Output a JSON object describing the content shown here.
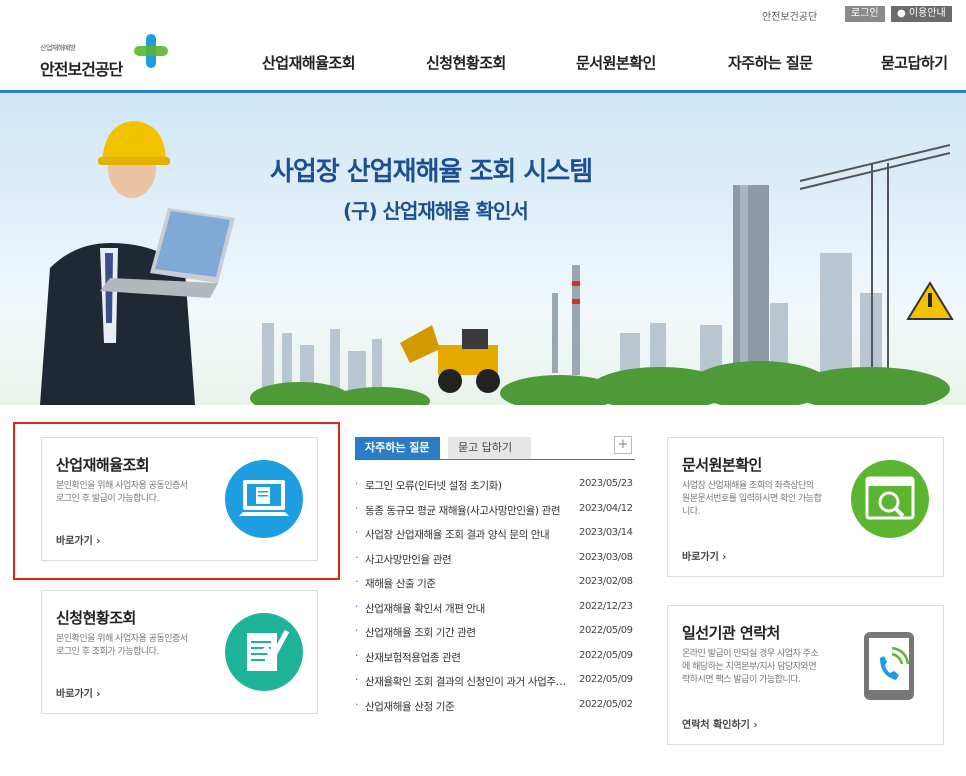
{
  "util": {
    "agency": "안전보건공단",
    "login": "로그인",
    "guide": "이용안내"
  },
  "logo": {
    "tagline": "산업재해예방",
    "name": "안전보건공단"
  },
  "nav": [
    "산업재해율조회",
    "신청현황조회",
    "문서원본확인",
    "자주하는 질문",
    "묻고답하기"
  ],
  "hero": {
    "title": "사업장 산업재해율 조회 시스템",
    "subtitle": "(구) 산업재해율 확인서"
  },
  "cards": {
    "rate": {
      "title": "산업재해율조회",
      "desc1": "본인확인을 위해 사업자용 공동인증서",
      "desc2": "로그인 후 발급이 가능합니다.",
      "link": "바로가기 ›"
    },
    "status": {
      "title": "신청현황조회",
      "desc1": "본인확인을 위해 사업자용 공동인증서",
      "desc2": "로그인 후 조회가 가능합니다.",
      "link": "바로가기 ›"
    },
    "doc": {
      "title": "문서원본확인",
      "desc1": "사업장 산업재해율 조회의 좌측상단의",
      "desc2": "원본문서번호를 입력하시면 확인 가능합",
      "desc3": "니다.",
      "link": "바로가기 ›"
    },
    "contact": {
      "title": "일선기관 연락처",
      "desc1": "온라인 발급이 안되실 경우 사업자 주소",
      "desc2": "에 해당하는 지역본부/지사 담당자와연",
      "desc3": "락하시면 팩스 발급이 가능합니다.",
      "link": "연락처 확인하기 ›"
    }
  },
  "board": {
    "tab_faq": "자주하는 질문",
    "tab_qna": "묻고 답하기",
    "more": "+",
    "items": [
      {
        "text": "로그인 오류(인터넷 설정 초기화)",
        "date": "2023/05/23"
      },
      {
        "text": "동종 동규모 평균 재해율(사고사망만인율) 관련",
        "date": "2023/04/12"
      },
      {
        "text": "사업장 산업재해율 조회 결과 양식 문의 안내",
        "date": "2023/03/14"
      },
      {
        "text": "사고사망만인율 관련",
        "date": "2023/03/08"
      },
      {
        "text": "재해율 산출 기준",
        "date": "2023/02/08"
      },
      {
        "text": "산업재해율 확인서 개편 안내",
        "date": "2022/12/23"
      },
      {
        "text": "산업재해율 조회 기간 관련",
        "date": "2022/05/09"
      },
      {
        "text": "산재보험적용업종 관련",
        "date": "2022/05/09"
      },
      {
        "text": "산재율확인 조회 결과의 신청인이 과거 사업주인 경우",
        "date": "2022/05/09"
      },
      {
        "text": "산업재해율 산정 기준",
        "date": "2022/05/02"
      }
    ]
  },
  "colors": {
    "accent": "#2a7cc7",
    "highlight": "#e2231a",
    "icon_blue": "#1e9de0",
    "icon_teal": "#1fb39a",
    "icon_green": "#5bb531",
    "icon_gray": "#777777"
  }
}
